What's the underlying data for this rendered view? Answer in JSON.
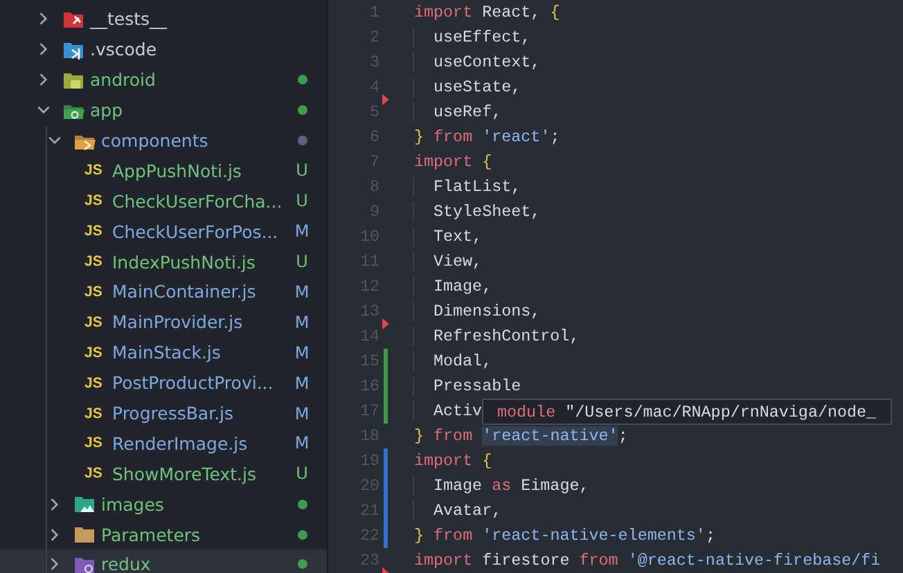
{
  "explorer": {
    "items": [
      {
        "name": "__tests__",
        "kind": "folder",
        "expanded": false,
        "untracked": false,
        "modified": false,
        "selected": false
      },
      {
        "name": ".vscode",
        "kind": "folder",
        "expanded": false,
        "untracked": false,
        "modified": false,
        "selected": false
      },
      {
        "name": "android",
        "kind": "folder",
        "expanded": false,
        "untracked": true,
        "modified": false,
        "color": "#3f9b4f",
        "selected": false
      },
      {
        "name": "app",
        "kind": "folder",
        "expanded": true,
        "untracked": true,
        "modified": false,
        "color": "#3f9b4f",
        "selected": false,
        "children": [
          {
            "name": "components",
            "kind": "folder",
            "expanded": true,
            "untracked": false,
            "modified": true,
            "color": "#56647e",
            "selected": false,
            "children": [
              {
                "name": "AppPushNoti.js",
                "kind": "file",
                "type_label": "JS",
                "untracked": true,
                "modified": false,
                "status": "U",
                "selected": false
              },
              {
                "name": "CheckUserForCha...",
                "kind": "file",
                "type_label": "JS",
                "untracked": true,
                "modified": false,
                "status": "U",
                "selected": false
              },
              {
                "name": "CheckUserForPos...",
                "kind": "file",
                "type_label": "JS",
                "untracked": false,
                "modified": true,
                "status": "M",
                "selected": false
              },
              {
                "name": "IndexPushNoti.js",
                "kind": "file",
                "type_label": "JS",
                "untracked": true,
                "modified": false,
                "status": "U",
                "selected": false
              },
              {
                "name": "MainContainer.js",
                "kind": "file",
                "type_label": "JS",
                "untracked": false,
                "modified": true,
                "status": "M",
                "selected": false
              },
              {
                "name": "MainProvider.js",
                "kind": "file",
                "type_label": "JS",
                "untracked": false,
                "modified": true,
                "status": "M",
                "selected": false
              },
              {
                "name": "MainStack.js",
                "kind": "file",
                "type_label": "JS",
                "untracked": false,
                "modified": true,
                "status": "M",
                "selected": false
              },
              {
                "name": "PostProductProvi...",
                "kind": "file",
                "type_label": "JS",
                "untracked": false,
                "modified": true,
                "status": "M",
                "selected": false
              },
              {
                "name": "ProgressBar.js",
                "kind": "file",
                "type_label": "JS",
                "untracked": false,
                "modified": true,
                "status": "M",
                "selected": false
              },
              {
                "name": "RenderImage.js",
                "kind": "file",
                "type_label": "JS",
                "untracked": false,
                "modified": true,
                "status": "M",
                "selected": false
              },
              {
                "name": "ShowMoreText.js",
                "kind": "file",
                "type_label": "JS",
                "untracked": true,
                "modified": false,
                "status": "U",
                "selected": false
              }
            ]
          },
          {
            "name": "images",
            "kind": "folder",
            "expanded": false,
            "untracked": true,
            "modified": false,
            "color": "#3f9b4f",
            "selected": false
          },
          {
            "name": "Parameters",
            "kind": "folder",
            "expanded": false,
            "untracked": true,
            "modified": false,
            "color": "#3f9b4f",
            "selected": false
          },
          {
            "name": "redux",
            "kind": "folder",
            "expanded": false,
            "untracked": true,
            "modified": false,
            "color": "#3f9b4f",
            "selected": true
          }
        ]
      }
    ]
  },
  "editor": {
    "lines": [
      {
        "number": "1",
        "indented": false,
        "tokens": [
          {
            "text": "import",
            "kind": "keyword"
          },
          {
            "text": " React, ",
            "kind": "plain"
          },
          {
            "text": "{",
            "kind": "brace"
          }
        ]
      },
      {
        "number": "2",
        "indented": true,
        "tokens": [
          {
            "text": "useEffect,",
            "kind": "plain"
          }
        ]
      },
      {
        "number": "3",
        "indented": true,
        "tokens": [
          {
            "text": "useContext,",
            "kind": "plain"
          }
        ]
      },
      {
        "number": "4",
        "indented": true,
        "deleted_marker": true,
        "tokens": [
          {
            "text": "useState,",
            "kind": "plain"
          }
        ]
      },
      {
        "number": "5",
        "indented": true,
        "tokens": [
          {
            "text": "useRef,",
            "kind": "plain"
          }
        ]
      },
      {
        "number": "6",
        "indented": false,
        "tokens": [
          {
            "text": "}",
            "kind": "brace"
          },
          {
            "text": " from ",
            "kind": "keyword"
          },
          {
            "text": "'react'",
            "kind": "string"
          },
          {
            "text": ";",
            "kind": "plain"
          }
        ]
      },
      {
        "number": "7",
        "indented": false,
        "tokens": [
          {
            "text": "import ",
            "kind": "keyword"
          },
          {
            "text": "{",
            "kind": "brace"
          }
        ]
      },
      {
        "number": "8",
        "indented": true,
        "tokens": [
          {
            "text": "FlatList,",
            "kind": "plain"
          }
        ]
      },
      {
        "number": "9",
        "indented": true,
        "tokens": [
          {
            "text": "StyleSheet,",
            "kind": "plain"
          }
        ]
      },
      {
        "number": "10",
        "indented": true,
        "tokens": [
          {
            "text": "Text,",
            "kind": "plain"
          }
        ]
      },
      {
        "number": "11",
        "indented": true,
        "tokens": [
          {
            "text": "View,",
            "kind": "plain"
          }
        ]
      },
      {
        "number": "12",
        "indented": true,
        "tokens": [
          {
            "text": "Image,",
            "kind": "plain"
          }
        ]
      },
      {
        "number": "13",
        "indented": true,
        "deleted_marker": true,
        "tokens": [
          {
            "text": "Dimensions,",
            "kind": "plain"
          }
        ]
      },
      {
        "number": "14",
        "indented": true,
        "tokens": [
          {
            "text": "RefreshControl,",
            "kind": "plain"
          }
        ]
      },
      {
        "number": "15",
        "indented": true,
        "added": true,
        "tokens": [
          {
            "text": "Modal,",
            "kind": "plain"
          }
        ]
      },
      {
        "number": "16",
        "indented": true,
        "added": true,
        "tokens": [
          {
            "text": "Pressable",
            "kind": "plain"
          }
        ]
      },
      {
        "number": "17",
        "indented": true,
        "added": true,
        "tokens": [
          {
            "text": "Activ",
            "kind": "plain"
          }
        ]
      },
      {
        "number": "18",
        "indented": false,
        "tokens": [
          {
            "text": "}",
            "kind": "brace"
          },
          {
            "text": " from ",
            "kind": "keyword"
          },
          {
            "text": "'react-native'",
            "kind": "string",
            "highlighted": true
          },
          {
            "text": ";",
            "kind": "plain"
          }
        ]
      },
      {
        "number": "19",
        "indented": false,
        "modified": true,
        "tokens": [
          {
            "text": "import ",
            "kind": "keyword"
          },
          {
            "text": "{",
            "kind": "brace"
          }
        ]
      },
      {
        "number": "20",
        "indented": true,
        "modified": true,
        "tokens": [
          {
            "text": "Image ",
            "kind": "plain"
          },
          {
            "text": "as",
            "kind": "keyword"
          },
          {
            "text": " Eimage,",
            "kind": "plain"
          }
        ]
      },
      {
        "number": "21",
        "indented": true,
        "modified": true,
        "tokens": [
          {
            "text": "Avatar,",
            "kind": "plain"
          }
        ]
      },
      {
        "number": "22",
        "indented": false,
        "modified": true,
        "tokens": [
          {
            "text": "}",
            "kind": "brace"
          },
          {
            "text": " from ",
            "kind": "keyword"
          },
          {
            "text": "'react-native-elements'",
            "kind": "string"
          },
          {
            "text": ";",
            "kind": "plain"
          }
        ]
      },
      {
        "number": "23",
        "indented": false,
        "deleted_marker": true,
        "tokens": [
          {
            "text": "import",
            "kind": "keyword"
          },
          {
            "text": " firestore ",
            "kind": "plain"
          },
          {
            "text": "from",
            "kind": "keyword"
          },
          {
            "text": " '@react-native-firebase/fi",
            "kind": "string"
          }
        ]
      }
    ],
    "tooltip": {
      "tokens": [
        {
          "text": "module",
          "kind": "keyword"
        },
        {
          "text": " \"/Users/mac/RNApp/rnNaviga/node_",
          "kind": "plain"
        }
      ]
    }
  }
}
